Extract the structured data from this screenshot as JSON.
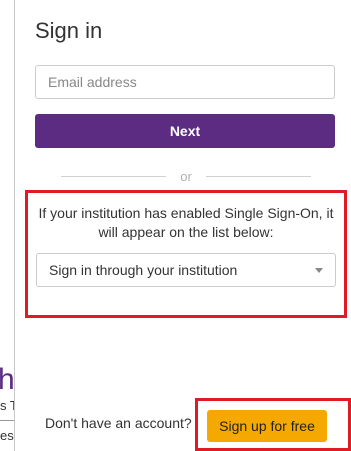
{
  "background_page": {
    "heading_fragment": "h",
    "line1_fragment": "s T",
    "line2_fragment": "es"
  },
  "panel": {
    "title": "Sign in",
    "email": {
      "placeholder": "Email address",
      "value": ""
    },
    "next_label": "Next",
    "divider_text": "or",
    "sso": {
      "description": "If your institution has enabled Single Sign-On, it will appear on the list below:",
      "select_value": "Sign in through your institution"
    },
    "footer": {
      "no_account_text": "Don't have an account?",
      "signup_label": "Sign up for free"
    }
  },
  "colors": {
    "brand_purple": "#5b2c82",
    "signup_orange": "#f5a800",
    "highlight_red": "#e01b24"
  }
}
